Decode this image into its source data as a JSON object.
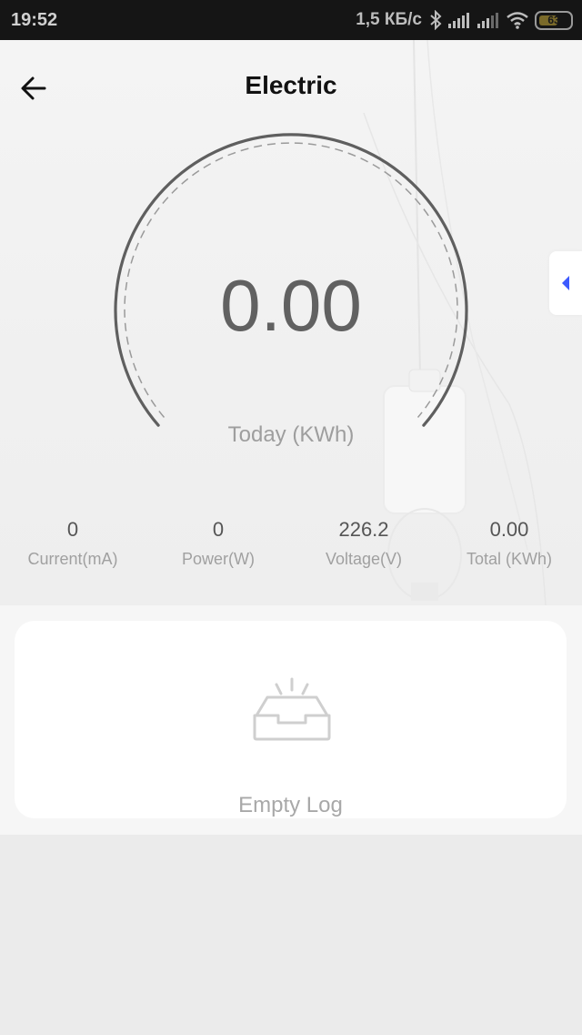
{
  "status_bar": {
    "time": "19:52",
    "network_speed": "1,5 КБ/с",
    "battery_level": "63",
    "icons": [
      "bluetooth-icon",
      "signal-icon",
      "signal-icon",
      "wifi-icon",
      "battery-icon"
    ]
  },
  "header": {
    "title": "Electric",
    "back_icon": "arrow-left-icon"
  },
  "gauge": {
    "value": "0.00",
    "label": "Today (KWh)"
  },
  "side_handle": {
    "icon": "caret-left-icon",
    "color": "#3d5afe"
  },
  "stats": [
    {
      "value": "0",
      "label": "Current(mA)"
    },
    {
      "value": "0",
      "label": "Power(W)"
    },
    {
      "value": "226.2",
      "label": "Voltage(V)"
    },
    {
      "value": "0.00",
      "label": "Total (KWh)"
    }
  ],
  "log": {
    "empty_text": "Empty Log",
    "icon": "empty-inbox-icon"
  },
  "colors": {
    "status_bar_bg": "#151515",
    "gauge_stroke": "#5f5f5f",
    "accent": "#3d5afe"
  }
}
